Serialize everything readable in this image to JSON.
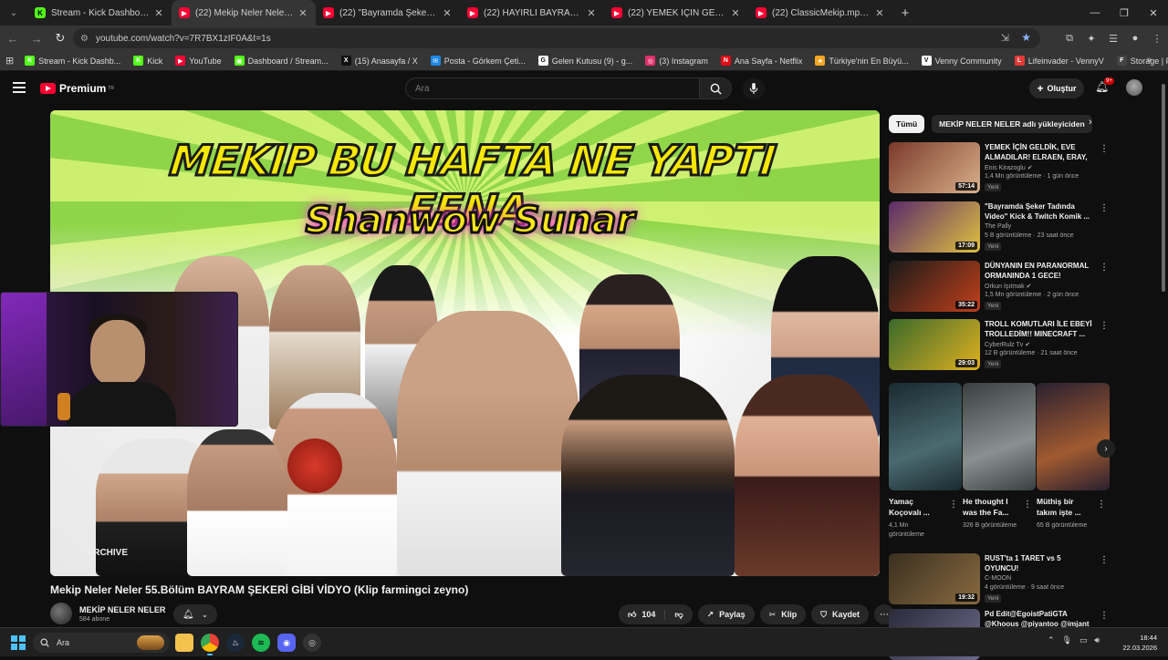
{
  "browser": {
    "tabs": [
      {
        "icon": "kick",
        "title": "Stream - Kick Dashboard",
        "active": false
      },
      {
        "icon": "yt",
        "title": "(22) Mekip Neler Neler 55.Bölüm",
        "active": true
      },
      {
        "icon": "yt",
        "title": "(22) \"Bayramda Şeker Tadında Vi",
        "active": false
      },
      {
        "icon": "yt",
        "title": "(22) HAYIRLI BAYRAMLAR | Mas",
        "active": false
      },
      {
        "icon": "yt",
        "title": "(22) YEMEK İÇİN GELDİK, EVE AL",
        "active": false
      },
      {
        "icon": "yt",
        "title": "(22) ClassicMekip.mp4 kıps :) -",
        "active": false
      }
    ],
    "url": "youtube.com/watch?v=7R7BX1zIF0A&t=1s",
    "bookmarks": [
      {
        "label": "Stream - Kick Dashb...",
        "color": "#53fc18",
        "glyph": "K"
      },
      {
        "label": "Kick",
        "color": "#53fc18",
        "glyph": "K"
      },
      {
        "label": "YouTube",
        "color": "#ff0033",
        "glyph": "▶"
      },
      {
        "label": "Dashboard / Stream...",
        "color": "#53fc18",
        "glyph": "▣"
      },
      {
        "label": "(15) Anasayfa / X",
        "color": "#111111",
        "glyph": "X"
      },
      {
        "label": "Posta - Görkem Çeti...",
        "color": "#1e88e5",
        "glyph": "✉"
      },
      {
        "label": "Gelen Kutusu (9) - g...",
        "color": "#ffffff",
        "glyph": "G"
      },
      {
        "label": "(3) Instagram",
        "color": "#e1306c",
        "glyph": "◎"
      },
      {
        "label": "Ana Sayfa - Netflix",
        "color": "#e50914",
        "glyph": "N"
      },
      {
        "label": "Türkiye'nin En Büyü...",
        "color": "#f5a623",
        "glyph": "★"
      },
      {
        "label": "Venny Community",
        "color": "#ffffff",
        "glyph": "V"
      },
      {
        "label": "Lifeinvader - VennyV",
        "color": "#e53935",
        "glyph": "L"
      },
      {
        "label": "Storage | Fivemanage",
        "color": "#444444",
        "glyph": "F"
      }
    ]
  },
  "youtube": {
    "logo_text": "Premium",
    "logo_sup": "TR",
    "search_placeholder": "Ara",
    "create_label": "Oluştur",
    "notif_count": "9+",
    "video": {
      "thumb_title_line1": "MEKIP BU HAFTA NE YAPTI FENA",
      "thumb_title_line2": "Shanwow Sunar",
      "title": "Mekip Neler Neler 55.Bölüm BAYRAM ŞEKERİ GİBİ VİDYO (Klip farmingci zeyno)",
      "channel": "MEKİP NELER NELER",
      "subscribers": "584 abone",
      "likes": "104",
      "share_label": "Paylaş",
      "clip_label": "Klip",
      "save_label": "Kaydet"
    },
    "chips": [
      "Tümü",
      "MEKİP NELER NELER adlı yükleyiciden"
    ],
    "recommendations": [
      {
        "title": "YEMEK İÇİN GELDİK, EVE ALMADILAR! ELRAEN, ERAY, ...",
        "channel": "Enis Kirazoglu",
        "verified": true,
        "meta": "1,4 Mn görüntüleme · 1 gün önce",
        "badge": "Yeni",
        "duration": "57:14",
        "color1": "#7a3a2a",
        "color2": "#d9b08a"
      },
      {
        "title": "\"Bayramda Şeker Tadında Video\" Kick & Twitch Komik ...",
        "channel": "The Pally",
        "verified": false,
        "meta": "5 B görüntüleme · 23 saat önce",
        "badge": "Yeni",
        "duration": "17:09",
        "color1": "#5a2a6a",
        "color2": "#e0c040"
      },
      {
        "title": "DÜNYANIN EN PARANORMAL ORMANINDA 1 GECE!",
        "channel": "Orkun Işıtmak",
        "verified": true,
        "meta": "1,5 Mn görüntüleme · 2 gün önce",
        "badge": "Yeni",
        "duration": "35:22",
        "color1": "#1a1a1a",
        "color2": "#c0401a"
      },
      {
        "title": "TROLL KOMUTLARI İLE EBEYİ TROLLEDİM!! MINECRAFT ...",
        "channel": "CyberRulz Tv",
        "verified": true,
        "meta": "12 B görüntüleme · 21 saat önce",
        "badge": "Yeni",
        "duration": "29:03",
        "color1": "#3a6a2a",
        "color2": "#e0b020"
      },
      {
        "title": "RUST'ta 1 TARET vs 5 OYUNCU!",
        "channel": "C-MOON",
        "verified": false,
        "meta": "4 görüntüleme · 9 saat önce",
        "badge": "Yeni",
        "duration": "19:32",
        "color1": "#3a3020",
        "color2": "#8a6a40"
      },
      {
        "title": "Pd Edit@EgoistPatiGTA @Khoous @piyantoo @imjant",
        "channel": "",
        "verified": false,
        "meta": "",
        "badge": "",
        "duration": "",
        "color1": "#2a2a3a",
        "color2": "#6a6a8a"
      }
    ],
    "shorts": [
      {
        "title": "Yamaç Koçovalı ...",
        "views": "4,1 Mn görüntüleme",
        "color1": "#1a2a30",
        "color2": "#4a6a70"
      },
      {
        "title": "He thought I was the Fa...",
        "views": "326 B görüntüleme",
        "color1": "#3a4040",
        "color2": "#8a9090"
      },
      {
        "title": "Müthiş bir takım işte ...",
        "views": "65 B görüntüleme",
        "color1": "#2a2030",
        "color2": "#a05a30"
      }
    ]
  },
  "taskbar": {
    "search_label": "Ara",
    "time": "18:44",
    "date": "22.03.2026"
  }
}
